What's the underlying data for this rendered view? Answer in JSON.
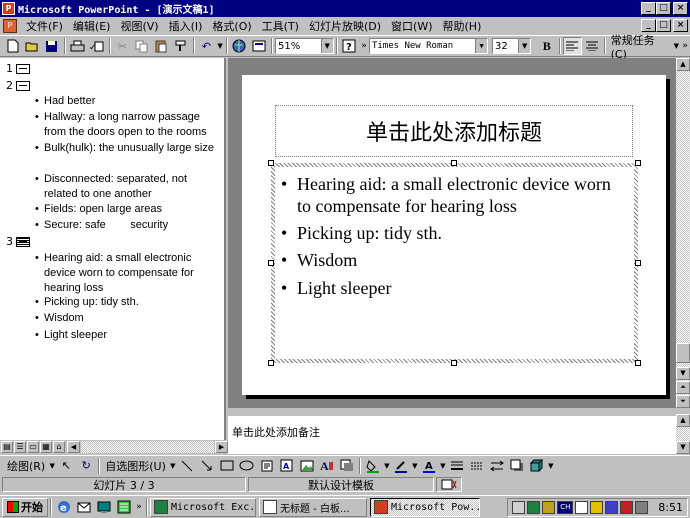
{
  "window": {
    "title": "Microsoft PowerPoint - [演示文稿1]",
    "app_icon": "P",
    "min": "_",
    "max": "□",
    "close": "×"
  },
  "menu": {
    "items": [
      "文件(F)",
      "编辑(E)",
      "视图(V)",
      "插入(I)",
      "格式(O)",
      "工具(T)",
      "幻灯片放映(D)",
      "窗口(W)",
      "帮助(H)"
    ]
  },
  "toolbar": {
    "zoom": "51%",
    "font": "Times New Roman",
    "size": "32",
    "bold": "B",
    "tasks": "常规任务(C)"
  },
  "outline": {
    "slide1": "1",
    "slide2": "2",
    "slide3": "3",
    "slide2_bullets": [
      "Had better",
      "Hallway: a long narrow passage from the doors open to the rooms",
      "Bulk(hulk): the unusually large size",
      "Disconnected: separated, not related to one another",
      "Fields: open large areas",
      "Secure: safe        security"
    ],
    "slide3_bullets": [
      "Hearing aid: a small electronic device worn to compensate for hearing loss",
      "Picking up: tidy sth.",
      "Wisdom",
      "Light sleeper"
    ]
  },
  "slide": {
    "title_placeholder": "单击此处添加标题",
    "bullets": [
      "Hearing aid: a small electronic device worn to compensate for hearing loss",
      "Picking up: tidy sth.",
      "Wisdom",
      "Light sleeper"
    ]
  },
  "notes": {
    "placeholder": "单击此处添加备注"
  },
  "drawbar": {
    "draw": "绘图(R)",
    "autoshapes": "自选图形(U)"
  },
  "status": {
    "slide": "幻灯片 3 / 3",
    "template": "默认设计模板"
  },
  "taskbar": {
    "start": "开始",
    "tasks": [
      "Microsoft Exc...",
      "无标题 - 白板...",
      "Microsoft Pow..."
    ],
    "clock": "8:51",
    "tray_ch": "CH"
  }
}
